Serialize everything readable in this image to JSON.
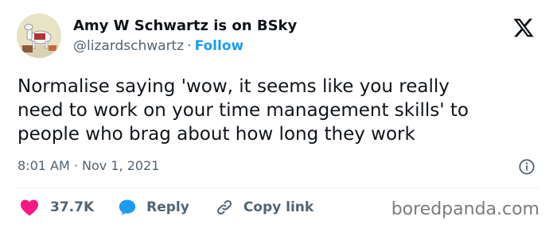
{
  "author": {
    "display_name": "Amy W Schwartz is on BSky",
    "handle": "@lizardschwartz",
    "separator": "·",
    "follow_label": "Follow",
    "avatar_icon": "llama-avatar"
  },
  "brand": {
    "logo_icon": "x-logo-icon",
    "color": "#0f1419"
  },
  "tweet": {
    "lines": [
      "Normalise saying 'wow, it seems like you really",
      "need to work on your time management skills' to",
      "people who brag about how long they work"
    ],
    "timestamp": "8:01 AM · Nov 1, 2021"
  },
  "actions": {
    "like_count": "37.7K",
    "like_color": "#f91880",
    "reply_label": "Reply",
    "reply_color": "#1d9bf0",
    "copy_label": "Copy link"
  },
  "colors": {
    "link": "#1d9bf0",
    "secondary_text": "#536471",
    "primary_text": "#0f1419"
  },
  "watermark": "boredpanda.com"
}
